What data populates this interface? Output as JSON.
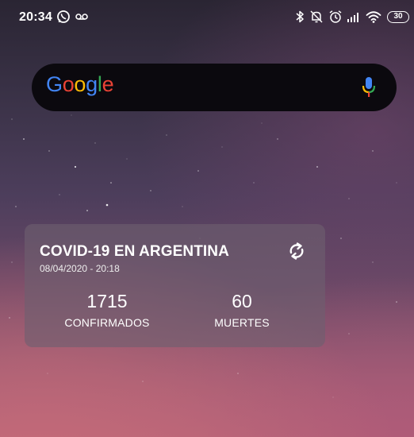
{
  "status_bar": {
    "time": "20:34",
    "battery": "30",
    "icons": [
      "whatsapp-icon",
      "voicemail-icon",
      "bluetooth-icon",
      "notifications-off-icon",
      "alarm-icon",
      "signal-icon",
      "wifi-icon",
      "battery-icon"
    ]
  },
  "search": {
    "logo_letters": [
      {
        "ch": "G",
        "color": "#4285F4"
      },
      {
        "ch": "o",
        "color": "#EA4335"
      },
      {
        "ch": "o",
        "color": "#FBBC05"
      },
      {
        "ch": "g",
        "color": "#4285F4"
      },
      {
        "ch": "l",
        "color": "#34A853"
      },
      {
        "ch": "e",
        "color": "#EA4335"
      }
    ],
    "mic_icon": "mic-icon"
  },
  "widget": {
    "title": "COVID-19 EN ARGENTINA",
    "datetime": "08/04/2020 - 20:18",
    "refresh_icon": "refresh-icon",
    "stats": [
      {
        "value": "1715",
        "label": "CONFIRMADOS"
      },
      {
        "value": "60",
        "label": "MUERTES"
      }
    ]
  }
}
